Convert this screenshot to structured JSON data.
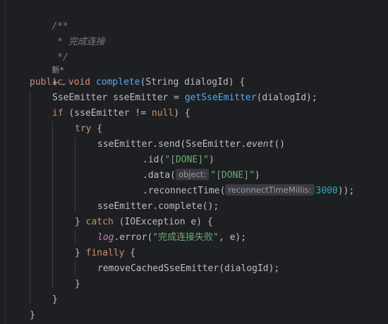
{
  "doc": {
    "c1": "/**",
    "c2": " * 完成连接",
    "c3": " */",
    "lens1_text": "新",
    "lens1_star": "*",
    "lens2_text": "⌄",
    "l_pub": "public",
    "l_void": "void",
    "l_complete": "complete",
    "l_sig": "(String dialogId) {",
    "l_decl_a": "SseEmitter sseEmitter = ",
    "l_decl_fn": "getSseEmitter",
    "l_decl_b": "(dialogId);",
    "l_if": "if",
    "l_if_a": " (sseEmitter != ",
    "l_null": "null",
    "l_if_b": ") {",
    "l_try": "try",
    "l_try_b": " {",
    "l_send_a": "sseEmitter.send(SseEmitter.",
    "l_event": "event",
    "l_send_b": "()",
    "l_id_a": ".id(",
    "l_done": "\"[DONE]\"",
    "l_id_b": ")",
    "l_data_a": ".data(",
    "l_hint_obj": "object:",
    "l_data_b": ")",
    "l_rt_a": ".reconnectTime(",
    "l_hint_rt": "reconnectTimeMillis:",
    "l_3000": "3000",
    "l_rt_b": "));",
    "l_comp": "sseEmitter.complete();",
    "l_catch_a": "} ",
    "l_catch": "catch",
    "l_catch_b": " (IOException e) {",
    "l_log": "log",
    "l_err_a": ".error(",
    "l_err_str": "\"完成连接失败\"",
    "l_err_b": ", e);",
    "l_fin_a": "} ",
    "l_finally": "finally",
    "l_fin_b": " {",
    "l_remove_fn": "removeCachedSseEmitter",
    "l_remove_b": "(dialogId);",
    "l_close": "}"
  }
}
